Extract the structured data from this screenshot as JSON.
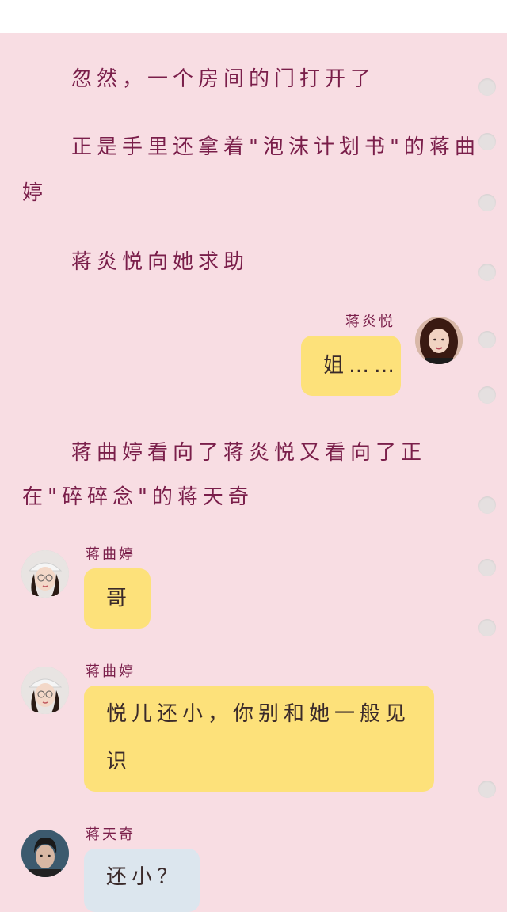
{
  "narration": [
    "忽然，一个房间的门打开了",
    "正是手里还拿着\"泡沫计划书\"的蒋曲",
    "婷",
    "蒋炎悦向她求助",
    "蒋曲婷看向了蒋炎悦又看向了正",
    "在\"碎碎念\"的蒋天奇"
  ],
  "messages": [
    {
      "sender": "蒋炎悦",
      "text": "姐……",
      "side": "right",
      "avatar": "woman-dark-hair-avatar"
    },
    {
      "sender": "蒋曲婷",
      "text": "哥",
      "side": "left",
      "avatar": "woman-white-cap-avatar"
    },
    {
      "sender": "蒋曲婷",
      "text_line1": "悦儿还小，你别和她一般见",
      "text_line2": "识",
      "side": "left",
      "avatar": "woman-white-cap-avatar"
    },
    {
      "sender": "蒋天奇",
      "text": "还小？",
      "side": "left",
      "avatar": "man-dark-hair-avatar"
    }
  ],
  "colors": {
    "paper": "#f8dde3",
    "narration_text": "#7a1e4a",
    "bubble_yellow": "#fde17a",
    "bubble_blue": "#dce6ee",
    "binder_hole": "#e5e0e0"
  }
}
